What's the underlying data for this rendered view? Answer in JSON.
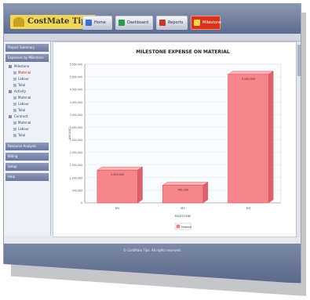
{
  "header": {
    "logo_text": "CostMate Tips",
    "nav": [
      {
        "label": "Home",
        "icon": "home-icon",
        "color": "#3c6fd0",
        "active": false
      },
      {
        "label": "Dashboard",
        "icon": "dashboard-icon",
        "color": "#2f9b4b",
        "active": false
      },
      {
        "label": "Reports",
        "icon": "report-icon",
        "color": "#c23b2b",
        "active": false
      },
      {
        "label": "Milestone",
        "icon": "chart-icon",
        "color": "#f4d54a",
        "active": true
      }
    ]
  },
  "sidebar": {
    "sections": [
      {
        "title": "Project Summary"
      },
      {
        "title": "Expenses by Milestone"
      },
      {
        "title": "Resource Analysis"
      },
      {
        "title": "Billing"
      },
      {
        "title": "Setup"
      },
      {
        "title": "Help"
      }
    ],
    "tree": [
      {
        "label": "Milestone",
        "level": 0,
        "selected": false
      },
      {
        "label": "Material",
        "level": 1,
        "selected": true
      },
      {
        "label": "Labour",
        "level": 1,
        "selected": false
      },
      {
        "label": "Total",
        "level": 1,
        "selected": false
      },
      {
        "label": "Activity",
        "level": 0,
        "selected": false
      },
      {
        "label": "Material",
        "level": 1,
        "selected": false
      },
      {
        "label": "Labour",
        "level": 1,
        "selected": false
      },
      {
        "label": "Total",
        "level": 1,
        "selected": false
      },
      {
        "label": "Contract",
        "level": 0,
        "selected": false
      },
      {
        "label": "Material",
        "level": 1,
        "selected": false
      },
      {
        "label": "Labour",
        "level": 1,
        "selected": false
      },
      {
        "label": "Total",
        "level": 1,
        "selected": false
      }
    ]
  },
  "footer": {
    "text": "© CostMate Tips. All rights reserved."
  },
  "colors": {
    "bar_fill": "#f7858c",
    "bar_edge": "#d44e57",
    "header": "#6d7aa0"
  },
  "chart_data": {
    "type": "bar",
    "title": "MILESTONE EXPENSE ON MATERIAL",
    "xlabel": "MILESTONE",
    "ylabel": "AMOUNT",
    "categories": [
      "M1",
      "M2",
      "M3"
    ],
    "series": [
      {
        "name": "Material",
        "values": [
          1300000,
          700000,
          5100000
        ]
      }
    ],
    "value_labels": [
      "1,300,000",
      "700,000",
      "5,100,000"
    ],
    "ylim": [
      0,
      5500000
    ],
    "yticks": [
      0,
      500000,
      1000000,
      1500000,
      2000000,
      2500000,
      3000000,
      3500000,
      4000000,
      4500000,
      5000000,
      5500000
    ],
    "ytick_labels": [
      "0",
      "500,000",
      "1,000,000",
      "1,500,000",
      "2,000,000",
      "2,500,000",
      "3,000,000",
      "3,500,000",
      "4,000,000",
      "4,500,000",
      "5,000,000",
      "5,500,000"
    ],
    "grid": true,
    "legend": "bottom-center"
  }
}
